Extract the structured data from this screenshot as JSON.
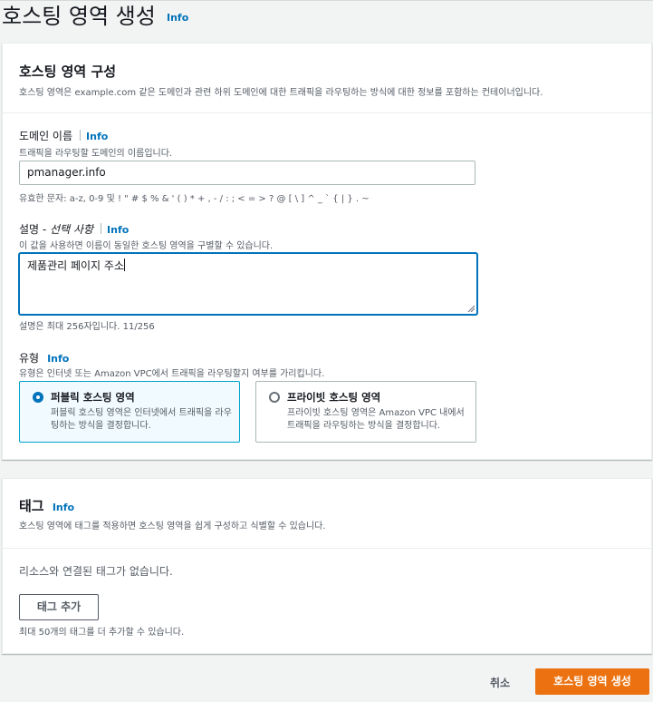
{
  "page": {
    "title": "호스팅 영역 생성",
    "info": "Info"
  },
  "config": {
    "title": "호스팅 영역 구성",
    "description": "호스팅 영역은 example.com 같은 도메인과 관련 하위 도메인에 대한 트래픽을 라우팅하는 방식에 대한 정보를 포함하는 컨테이너입니다.",
    "domain": {
      "label": "도메인 이름",
      "info": "Info",
      "description": "트래픽을 라우팅할 도메인의 이름입니다.",
      "value": "pmanager.info",
      "hint": "유효한 문자: a-z, 0-9 및 ! \" # $ % & ' ( ) * + , - / : ; < = > ? @ [ \\ ] ^ _ ` { | } . ~"
    },
    "comment": {
      "label": "설명 - ",
      "label_optional": "선택 사항",
      "info": "Info",
      "description": "이 값을 사용하면 이름이 동일한 호스팅 영역을 구별할 수 있습니다.",
      "value": "제품관리 페이지 주소",
      "hint": "설명은 최대 256자입니다. 11/256"
    },
    "type": {
      "label": "유형",
      "info": "Info",
      "description": "유형은 인터넷 또는 Amazon VPC에서 트래픽을 라우팅할지 여부를 가리킵니다.",
      "options": [
        {
          "title": "퍼블릭 호스팅 영역",
          "description": "퍼블릭 호스팅 영역은 인터넷에서 트래픽을 라우팅하는 방식을 결정합니다.",
          "selected": true
        },
        {
          "title": "프라이빗 호스팅 영역",
          "description": "프라이빗 호스팅 영역은 Amazon VPC 내에서 트래픽을 라우팅하는 방식을 결정합니다.",
          "selected": false
        }
      ]
    }
  },
  "tags": {
    "title": "태그",
    "info": "Info",
    "description": "호스팅 영역에 태그를 적용하면 호스팅 영역을 쉽게 구성하고 식별할 수 있습니다.",
    "empty": "리소스와 연결된 태그가 없습니다.",
    "add_button": "태그 추가",
    "hint": "최대 50개의 태그를 더 추가할 수 있습니다."
  },
  "footer": {
    "cancel": "취소",
    "submit": "호스팅 영역 생성"
  },
  "colors": {
    "primary": "#ec7211",
    "link": "#0073bb",
    "selected_border": "#00a1c9",
    "selected_bg": "#f1faff"
  }
}
